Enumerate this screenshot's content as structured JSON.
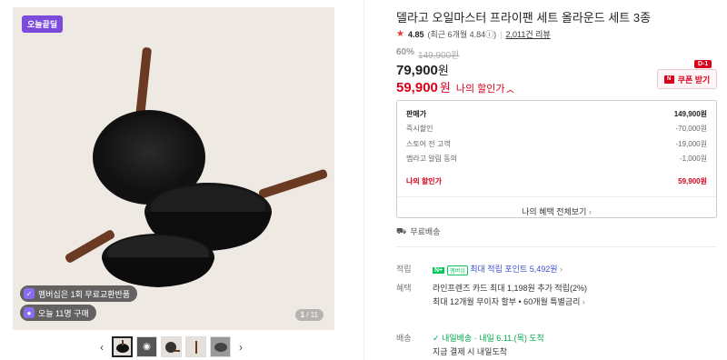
{
  "gallery": {
    "top_badge": "오늘끝딜",
    "membership_pill": "멤버십은 1회 무료교환반품",
    "purchase_pill": "오늘 11명 구매",
    "counter_current": "1",
    "counter_total": "11",
    "thumbnails": 5,
    "prev_icon": "chevron-left-icon",
    "next_icon": "chevron-right-icon"
  },
  "product": {
    "title": "델라고 오일마스터 프라이팬 세트 올라운드 세트 3종",
    "rating_score": "4.85",
    "rating_recent": "(최근 6개월 4.84ⓘ)",
    "review_count": "2,011건 리뷰",
    "discount_pct": "60%",
    "original_price": "149,900원",
    "price": "79,900",
    "price_unit": "원",
    "my_price": "59,900",
    "my_price_unit": "원",
    "my_price_label": "나의 할인가",
    "coupon_label": "쿠폰 받기",
    "coupon_badge": "D-1"
  },
  "price_breakdown": {
    "rows": [
      {
        "label": "판매가",
        "value": "149,900원"
      },
      {
        "label": "즉시할인",
        "value": "-70,000원"
      },
      {
        "label": "스토어 전 고객",
        "value": "-19,000원"
      },
      {
        "label": "멤라고 알림 동의",
        "value": "-1,000원"
      }
    ],
    "my_label": "나의 할인가",
    "my_value": "59,900원",
    "benefit_link": "나의 혜택 전체보기"
  },
  "shipping": {
    "free_label": "무료배송"
  },
  "details": {
    "points_label": "적립",
    "points_text": "최대 적립 포인트 5,492원",
    "benefit_label": "혜택",
    "benefit_line1": "라인프렌즈 카드 최대 1,198원 추가 적립(2%)",
    "benefit_line2": "최대 12개월 무이자 할부 • 60개월 특별금리",
    "delivery_label": "배송",
    "delivery_tag": "내일배송",
    "delivery_date": "· 내일 6.11.(목) 도착",
    "delivery_sub": "지금 결제 시 내일도착"
  },
  "colors": {
    "accent_red": "#d9001b",
    "badge_purple": "#7b4cdb",
    "naver_green": "#03c75a"
  }
}
